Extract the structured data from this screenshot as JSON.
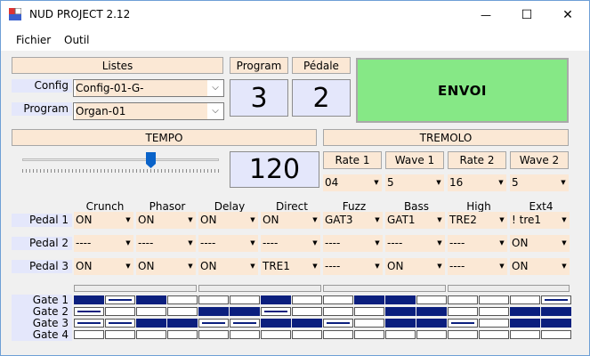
{
  "window": {
    "title": "NUD PROJECT 2.12",
    "min_glyph": "—",
    "max_glyph": "☐",
    "close_glyph": "✕"
  },
  "menu": [
    "Fichier",
    "Outil"
  ],
  "listes": {
    "header": "Listes",
    "config_label": "Config",
    "config_value": "Config-01-G-",
    "program_label": "Program",
    "program_value": "Organ-01"
  },
  "program": {
    "header": "Program",
    "value": "3"
  },
  "pedale": {
    "header": "Pédale",
    "value": "2"
  },
  "envoi_label": "ENVOI",
  "tempo": {
    "header": "TEMPO",
    "value": "120",
    "slider_fraction": 0.66
  },
  "tremolo": {
    "header": "TREMOLO",
    "headers": [
      "Rate 1",
      "Wave 1",
      "Rate 2",
      "Wave 2"
    ],
    "values": [
      "04",
      "5",
      "16",
      "5"
    ]
  },
  "effects": {
    "columns": [
      "Crunch",
      "Phasor",
      "Delay",
      "Direct",
      "Fuzz",
      "Bass",
      "High",
      "Ext4"
    ],
    "rows": [
      {
        "label": "Pedal 1",
        "values": [
          "ON",
          "ON",
          "ON",
          "ON",
          "GAT3",
          "GAT1",
          "TRE2",
          "! tre1"
        ]
      },
      {
        "label": "Pedal 2",
        "values": [
          "----",
          "----",
          "----",
          "----",
          "----",
          "----",
          "----",
          "ON"
        ]
      },
      {
        "label": "Pedal 3",
        "values": [
          "ON",
          "ON",
          "ON",
          "TRE1",
          "----",
          "ON",
          "----",
          "ON"
        ]
      }
    ]
  },
  "gates": {
    "labels": [
      "Gate 1",
      "Gate 2",
      "Gate 3",
      "Gate 4"
    ],
    "patterns": [
      [
        1,
        "m",
        1,
        0,
        0,
        0,
        1,
        0,
        0,
        1,
        1,
        0,
        0,
        0,
        0,
        "m"
      ],
      [
        "m",
        0,
        0,
        0,
        1,
        1,
        "m",
        0,
        0,
        0,
        1,
        1,
        0,
        0,
        1,
        1
      ],
      [
        "m",
        "m",
        1,
        1,
        "m",
        "m",
        1,
        1,
        "m",
        0,
        1,
        1,
        "m",
        0,
        1,
        1
      ],
      [
        0,
        0,
        0,
        0,
        0,
        0,
        0,
        0,
        0,
        0,
        0,
        0,
        0,
        0,
        0,
        0
      ]
    ]
  },
  "colors": {
    "accent_blue": "#0b1f7e",
    "envoi_green": "#86e886",
    "header_peach": "#fbe8d5",
    "label_lavender": "#e4e7fb"
  }
}
